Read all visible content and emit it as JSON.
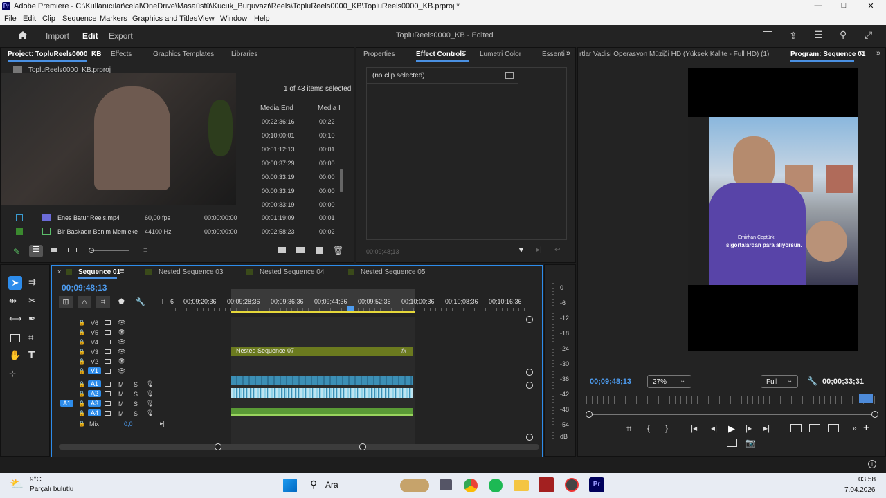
{
  "window": {
    "title": "Adobe Premiere - C:\\Kullanıcılar\\celal\\OneDrive\\Masaüstü\\Kucuk_Burjuvazi\\Reels\\TopluReels0000_KB\\TopluReels0000_KB.prproj *",
    "minimize": "—",
    "maximize": "□",
    "close": "✕"
  },
  "menu": [
    "File",
    "Edit",
    "Clip",
    "Sequence",
    "Markers",
    "Graphics and Titles",
    "View",
    "Window",
    "Help"
  ],
  "appbar": {
    "import": "Import",
    "edit": "Edit",
    "export": "Export",
    "doc_title": "TopluReels0000_KB - Edited"
  },
  "project": {
    "tabs": [
      "Project: TopluReels0000_KB",
      "Effects",
      "Graphics Templates",
      "Libraries"
    ],
    "file": "TopluReels0000_KB.prproj",
    "selection": "1 of 43 items selected",
    "columns": [
      "Media End",
      "Media I"
    ],
    "rows": [
      {
        "name": "",
        "rate": "",
        "start": "",
        "end": "00:22:36:16",
        "dur": "00:22"
      },
      {
        "name": "",
        "rate": "",
        "start": "",
        "end": "00;10;00;01",
        "dur": "00;10"
      },
      {
        "name": "",
        "rate": "",
        "start": "",
        "end": "00:01:12:13",
        "dur": "00:01"
      },
      {
        "name": "",
        "rate": "",
        "start": "",
        "end": "00:00:37:29",
        "dur": "00:00"
      },
      {
        "name": "",
        "rate": "",
        "start": "",
        "end": "00:00:33:19",
        "dur": "00:00"
      },
      {
        "name": "",
        "rate": "",
        "start": "",
        "end": "00:00:33:19",
        "dur": "00:00"
      },
      {
        "name": "",
        "rate": "",
        "start": "",
        "end": "00:00:33:19",
        "dur": "00:00"
      },
      {
        "name": "Enes Batur Reels.mp4",
        "rate": "60,00 fps",
        "start": "00:00:00:00",
        "end": "00:01:19:09",
        "dur": "00:01"
      },
      {
        "name": "Bir Baskadır Benim Memleke",
        "rate": "44100 Hz",
        "start": "00:00:00:00",
        "end": "00:02:58:23",
        "dur": "00:02"
      }
    ]
  },
  "effects": {
    "tabs": [
      "Properties",
      "Effect Controls",
      "Lumetri Color",
      "Essenti"
    ],
    "no_clip": "(no clip selected)",
    "timecode": "00;09;48;13"
  },
  "program": {
    "source_tab": "rtlar Vadisi Operasyon Müziği HD (Yüksek Kalite - Full HD) (1).mp3",
    "tab": "Program: Sequence 01",
    "timecode": "00;09;48;13",
    "zoom": "27%",
    "quality": "Full",
    "duration": "00;00;33;31",
    "caption_name": "Emirhan Çeptürk",
    "caption_text": "sigortalardan para alıyorsun."
  },
  "timeline": {
    "tabs": [
      "Sequence 01",
      "Nested Sequence 03",
      "Nested Sequence 04",
      "Nested Sequence 05"
    ],
    "timecode": "00;09;48;13",
    "ruler": [
      "6",
      "00;09;20;36",
      "00;09;28;36",
      "00;09;36;36",
      "00;09;44;36",
      "00;09;52;36",
      "00;10;00;36",
      "00;10;08;36",
      "00;10;16;36"
    ],
    "video_tracks": [
      "V6",
      "V5",
      "V4",
      "V3",
      "V2",
      "V1"
    ],
    "audio_tracks": [
      "A1",
      "A2",
      "A3",
      "A4"
    ],
    "source_patch": "A1",
    "mix_label": "Mix",
    "mix_value": "0,0",
    "nested_clip": "Nested Sequence 07",
    "fx": "fx"
  },
  "meter": {
    "ticks": [
      "0",
      "-6",
      "-12",
      "-18",
      "-24",
      "-30",
      "-36",
      "-42",
      "-48",
      "-54",
      "dB"
    ]
  },
  "taskbar": {
    "temp": "9°C",
    "weather": "Parçalı bulutlu",
    "search": "Ara",
    "time": "03:58",
    "date": "7.04.2026"
  },
  "colors": {
    "accent": "#2d8ceb",
    "nested_clip": "#6b7a1f",
    "audio_clip": "#3c8fb5",
    "playhead": "#6aa9ff"
  }
}
